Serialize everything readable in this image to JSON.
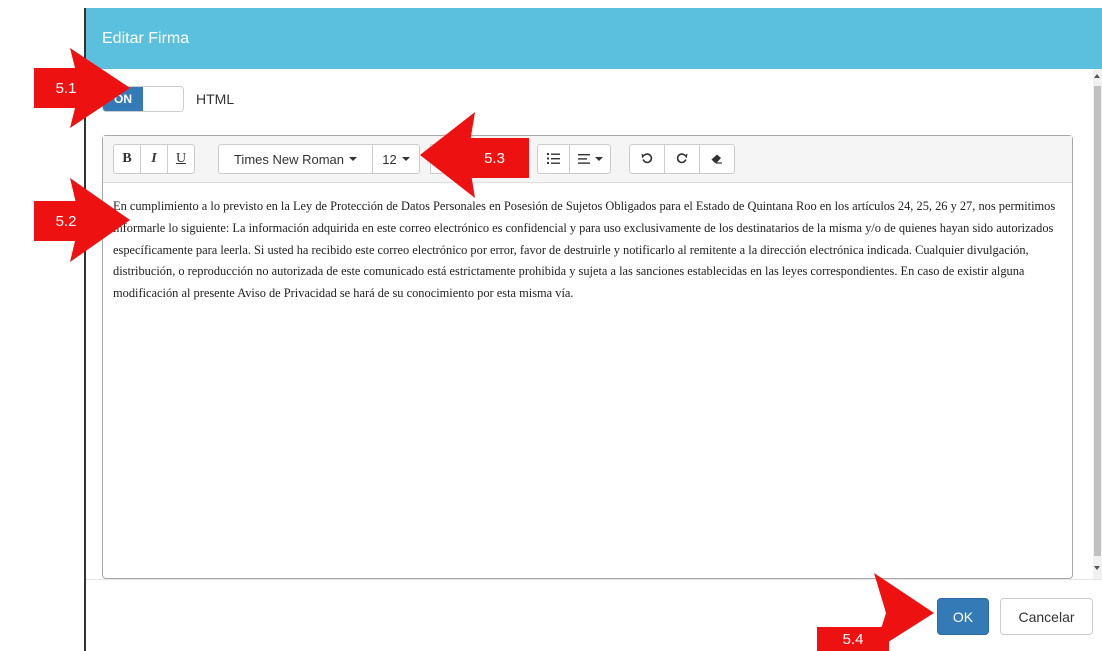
{
  "modal": {
    "title": "Editar Firma"
  },
  "toggle": {
    "on_label": "ON",
    "label": "HTML"
  },
  "toolbar": {
    "bold": "B",
    "italic": "I",
    "underline": "U",
    "font_family": "Times New Roman",
    "font_size": "12"
  },
  "editor": {
    "content": "En cumplimiento a lo previsto en la Ley de Protección de Datos Personales en Posesión de Sujetos Obligados para el Estado de Quintana Roo en los artículos 24, 25, 26 y 27, nos permitimos informarle lo siguiente: La información adquirida en este correo electrónico es confidencial y para uso exclusivamente de los destinatarios de la misma y/o de quienes hayan sido autorizados específicamente para leerla. Si usted ha recibido este correo electrónico por error, favor de destruirle y notificarlo al remitente a la dirección electrónica indicada. Cualquier divulgación, distribución, o reproducción no autorizada de este comunicado está estrictamente prohibida y sujeta a las sanciones establecidas en las leyes correspondientes. En caso de existir alguna modificación al presente Aviso de Privacidad se hará de su conocimiento por esta misma vía."
  },
  "footer": {
    "ok_label": "OK",
    "cancel_label": "Cancelar"
  },
  "callouts": {
    "c51": "5.1",
    "c52": "5.2",
    "c53": "5.3",
    "c54": "5.4"
  },
  "colors": {
    "header": "#5bc0de",
    "primary": "#337ab7",
    "callout": "#ee1111"
  }
}
